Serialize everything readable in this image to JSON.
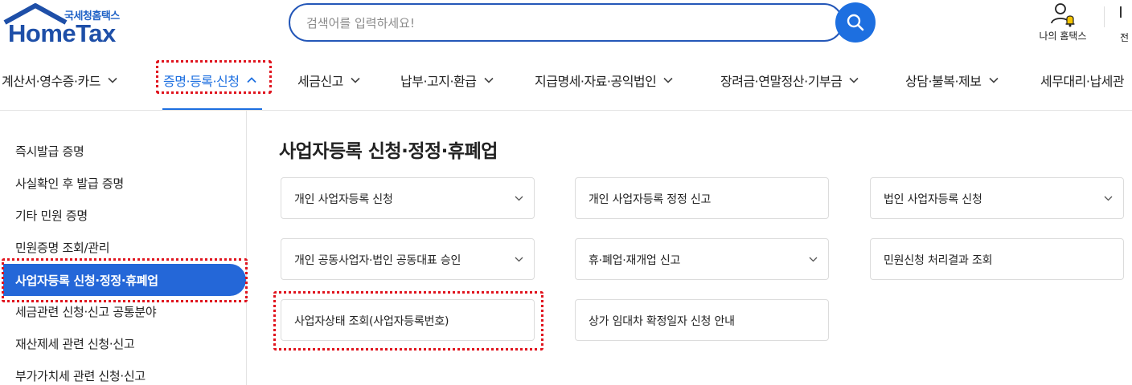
{
  "header": {
    "logo_sub": "국세청홈택스",
    "logo_main": "HomeTax",
    "search_placeholder": "검색어를 입력하세요!",
    "my_hometax_label": "나의 홈택스",
    "all_menu_label": "전"
  },
  "gnb": {
    "items": [
      {
        "label": "계산서·영수증·카드"
      },
      {
        "label": "증명·등록·신청"
      },
      {
        "label": "세금신고"
      },
      {
        "label": "납부·고지·환급"
      },
      {
        "label": "지급명세·자료·공익법인"
      },
      {
        "label": "장려금·연말정산·기부금"
      },
      {
        "label": "상담·불복·제보"
      },
      {
        "label": "세무대리·납세관"
      }
    ],
    "active_label": "증명·등록·신청"
  },
  "sidebar": {
    "items": [
      {
        "label": "즉시발급 증명"
      },
      {
        "label": "사실확인 후 발급 증명"
      },
      {
        "label": "기타 민원 증명"
      },
      {
        "label": "민원증명 조회/관리"
      },
      {
        "label": "사업자등록 신청·정정·휴폐업"
      },
      {
        "label": "세금관련 신청·신고 공통분야"
      },
      {
        "label": "재산제세 관련 신청·신고"
      },
      {
        "label": "부가가치세 관련 신청·신고"
      }
    ],
    "active_label": "사업자등록 신청·정정·휴폐업"
  },
  "main": {
    "title": "사업자등록 신청·정정·휴폐업",
    "cards": [
      {
        "label": "개인 사업자등록 신청",
        "has_dropdown": true
      },
      {
        "label": "개인 사업자등록 정정 신고",
        "has_dropdown": false
      },
      {
        "label": "법인 사업자등록 신청",
        "has_dropdown": true
      },
      {
        "label": "개인 공동사업자·법인 공동대표 승인",
        "has_dropdown": true
      },
      {
        "label": "휴·폐업·재개업 신고",
        "has_dropdown": true
      },
      {
        "label": "민원신청 처리결과 조회",
        "has_dropdown": false
      },
      {
        "label": "사업자상태 조회(사업자등록번호)",
        "has_dropdown": false
      },
      {
        "label": "상가 임대차 확정일자 신청 안내",
        "has_dropdown": false
      }
    ]
  },
  "colors": {
    "brand_blue": "#1d6fe0",
    "logo_navy": "#1e4fa8",
    "sidebar_active_bg": "#2467d8",
    "highlight_red": "#e0141e",
    "bell_yellow": "#f5c400"
  },
  "icons": [
    "house-logo-icon",
    "search-icon",
    "user-bell-icon",
    "chevron-down-icon",
    "chevron-up-icon"
  ]
}
